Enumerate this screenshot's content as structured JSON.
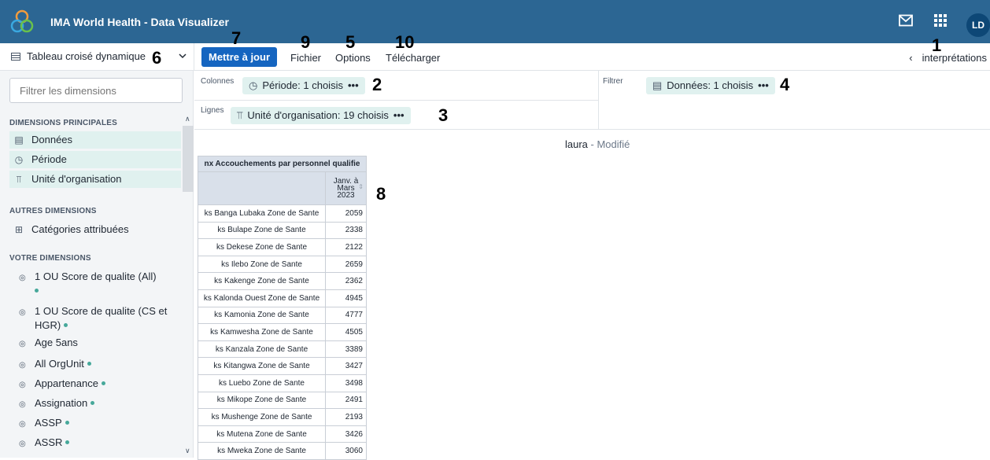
{
  "app": {
    "title": "IMA World Health - Data Visualizer",
    "avatar": "LD"
  },
  "toolbar": {
    "vis_type": "Tableau croisé dynamique",
    "update": "Mettre à jour",
    "file": "Fichier",
    "options": "Options",
    "download": "Télécharger",
    "interpretations": "interprétations"
  },
  "annotations": {
    "n1": "1",
    "n2": "2",
    "n3": "3",
    "n4": "4",
    "n5": "5",
    "n6": "6",
    "n7": "7",
    "n8": "8",
    "n9": "9",
    "n10": "10"
  },
  "sidebar": {
    "filter_placeholder": "Filtrer les dimensions",
    "main_header": "DIMENSIONS PRINCIPALES",
    "main_items": [
      "Données",
      "Période",
      "Unité d'organisation"
    ],
    "other_header": "AUTRES DIMENSIONS",
    "other_items": [
      "Catégories attribuées"
    ],
    "your_header": "VOTRE DIMENSIONS",
    "your_items": [
      "1 OU Score de qualite (All)",
      "1 OU Score de qualite (CS et HGR)",
      "Age 5ans",
      "All OrgUnit",
      "Appartenance",
      "Assignation",
      "ASSP",
      "ASSR"
    ]
  },
  "layout": {
    "columns_label": "Colonnes",
    "rows_label": "Lignes",
    "filter_label": "Filtrer",
    "columns_chip": "Période: 1 choisis",
    "rows_chip": "Unité d'organisation: 19 choisis",
    "filter_chip": "Données: 1 choisis",
    "more": "•••"
  },
  "visualization": {
    "name": "laura",
    "status": " - Modifié"
  },
  "table": {
    "header": "nx Accouchements par personnel qualifie",
    "column": [
      "Janv. à",
      "Mars",
      "2023"
    ],
    "rows": [
      {
        "org": "ks Banga Lubaka Zone de Sante",
        "value": "2059"
      },
      {
        "org": "ks Bulape Zone de Sante",
        "value": "2338"
      },
      {
        "org": "ks Dekese Zone de Sante",
        "value": "2122"
      },
      {
        "org": "ks Ilebo Zone de Sante",
        "value": "2659"
      },
      {
        "org": "ks Kakenge Zone de Sante",
        "value": "2362"
      },
      {
        "org": "ks Kalonda Ouest Zone de Sante",
        "value": "4945"
      },
      {
        "org": "ks Kamonia Zone de Sante",
        "value": "4777"
      },
      {
        "org": "ks Kamwesha Zone de Sante",
        "value": "4505"
      },
      {
        "org": "ks Kanzala Zone de Sante",
        "value": "3389"
      },
      {
        "org": "ks Kitangwa Zone de Sante",
        "value": "3427"
      },
      {
        "org": "ks Luebo Zone de Sante",
        "value": "3498"
      },
      {
        "org": "ks Mikope Zone de Sante",
        "value": "2491"
      },
      {
        "org": "ks Mushenge Zone de Sante",
        "value": "2193"
      },
      {
        "org": "ks Mutena Zone de Sante",
        "value": "3426"
      },
      {
        "org": "ks Mweka Zone de Sante",
        "value": "3060"
      }
    ]
  }
}
